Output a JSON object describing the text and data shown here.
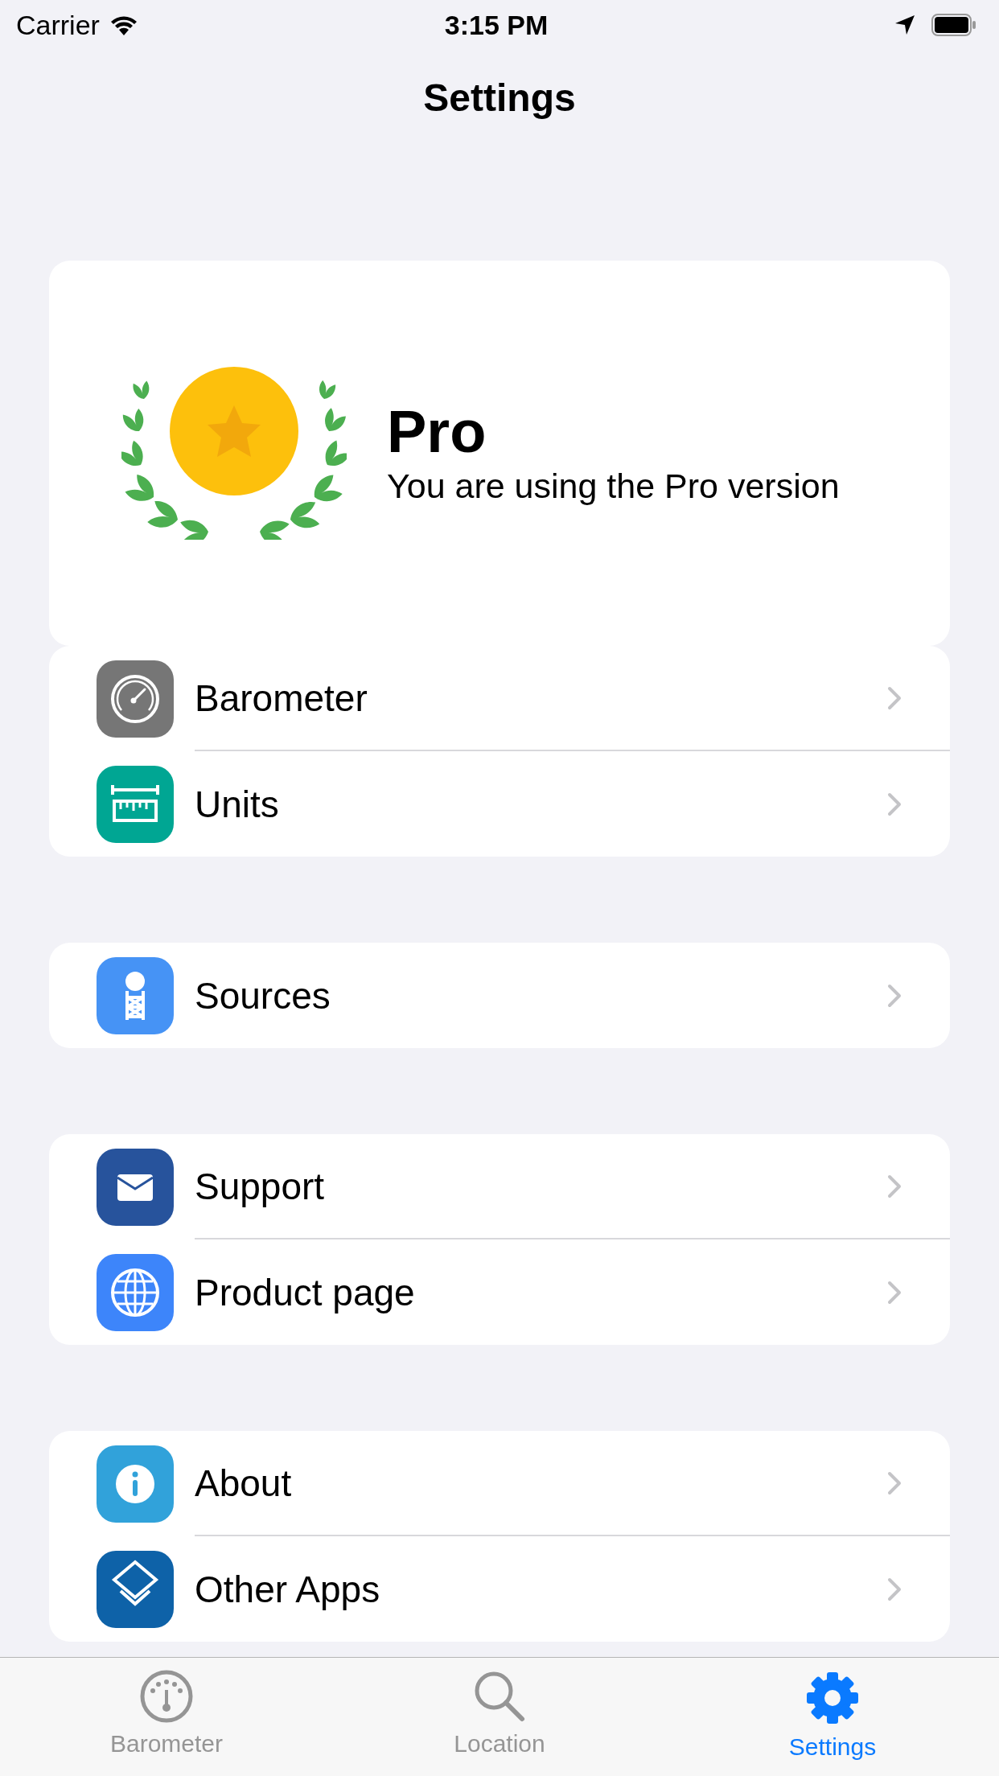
{
  "status_bar": {
    "carrier": "Carrier",
    "time": "3:15 PM"
  },
  "nav": {
    "title": "Settings"
  },
  "pro_card": {
    "title": "Pro",
    "subtitle": "You are using the Pro version"
  },
  "groups": [
    {
      "rows": [
        {
          "label": "Barometer",
          "color": "#767676"
        },
        {
          "label": "Units",
          "color": "#00a693"
        }
      ]
    },
    {
      "rows": [
        {
          "label": "Sources",
          "color": "#4693f5"
        }
      ]
    },
    {
      "rows": [
        {
          "label": "Support",
          "color": "#27539c"
        },
        {
          "label": "Product page",
          "color": "#3d85fa"
        }
      ]
    },
    {
      "rows": [
        {
          "label": "About",
          "color": "#31a2da"
        },
        {
          "label": "Other Apps",
          "color": "#0e62a8"
        }
      ]
    }
  ],
  "tabs": [
    {
      "label": "Barometer",
      "selected": false
    },
    {
      "label": "Location",
      "selected": false
    },
    {
      "label": "Settings",
      "selected": true
    }
  ]
}
